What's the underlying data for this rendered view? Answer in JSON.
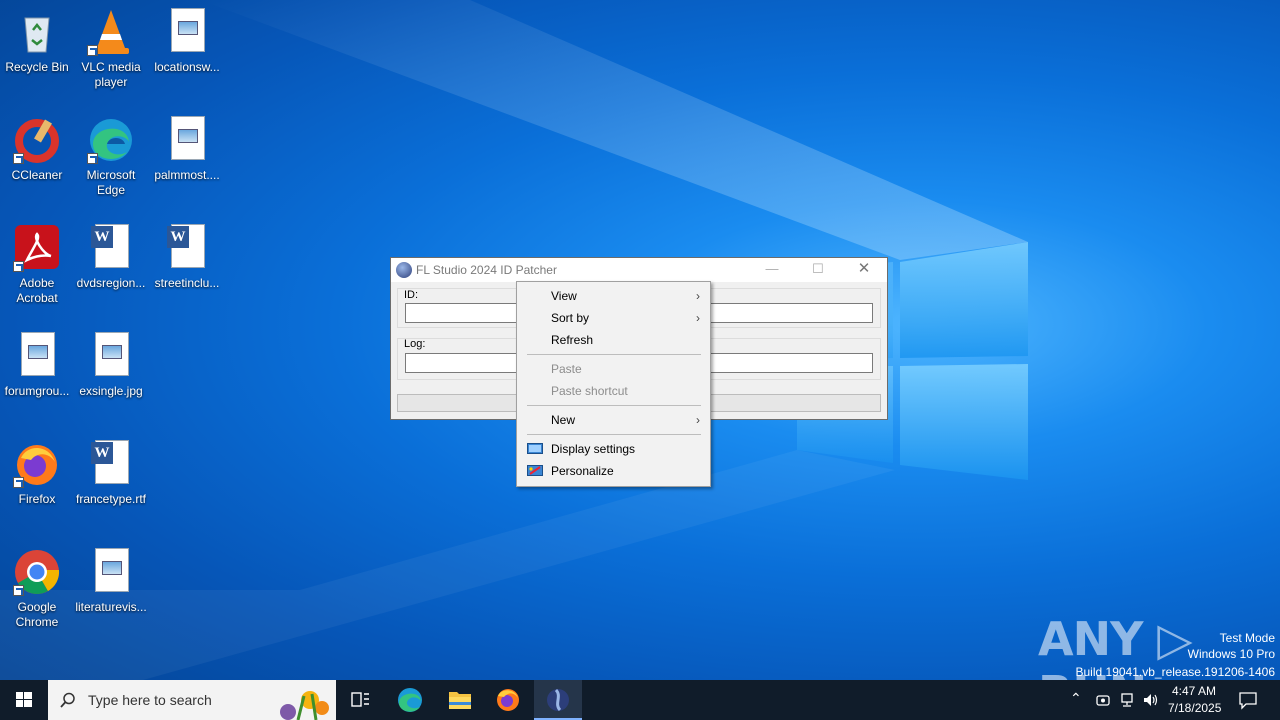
{
  "desktop": {
    "icons": [
      {
        "label": "Recycle Bin",
        "type": "recycle"
      },
      {
        "label": "VLC media player",
        "type": "vlc"
      },
      {
        "label": "locationsw...",
        "type": "image"
      },
      {
        "label": "CCleaner",
        "type": "ccleaner"
      },
      {
        "label": "Microsoft Edge",
        "type": "edge"
      },
      {
        "label": "palmmost....",
        "type": "image"
      },
      {
        "label": "Adobe Acrobat",
        "type": "acrobat"
      },
      {
        "label": "dvdsregion...",
        "type": "word"
      },
      {
        "label": "streetinclu...",
        "type": "word"
      },
      {
        "label": "forumgrou...",
        "type": "image"
      },
      {
        "label": "exsingle.jpg",
        "type": "image"
      },
      {
        "label": "Firefox",
        "type": "firefox"
      },
      {
        "label": "francetype.rtf",
        "type": "word"
      },
      {
        "label": "Google Chrome",
        "type": "chrome"
      },
      {
        "label": "literaturevis...",
        "type": "image"
      }
    ]
  },
  "app_window": {
    "title": "FL Studio 2024 ID Patcher",
    "id_label": "ID:",
    "log_label": "Log:",
    "minimize": "—",
    "maximize": "☐",
    "close": "✕"
  },
  "context_menu": {
    "items": [
      {
        "label": "View",
        "submenu": true
      },
      {
        "label": "Sort by",
        "submenu": true
      },
      {
        "label": "Refresh"
      },
      {
        "label": "Paste",
        "disabled": true
      },
      {
        "label": "Paste shortcut",
        "disabled": true
      },
      {
        "label": "New",
        "submenu": true
      },
      {
        "label": "Display settings",
        "icon": "display-icon"
      },
      {
        "label": "Personalize",
        "icon": "personalize-icon"
      }
    ],
    "arrow": "›"
  },
  "watermark": {
    "brand": "ANY ▷ RUN",
    "mode": "Test Mode",
    "edition": "Windows 10 Pro",
    "build": "Build 19041.vb_release.191206-1406"
  },
  "taskbar": {
    "search_placeholder": "Type here to search",
    "time": "4:47 AM",
    "date": "7/18/2025"
  }
}
